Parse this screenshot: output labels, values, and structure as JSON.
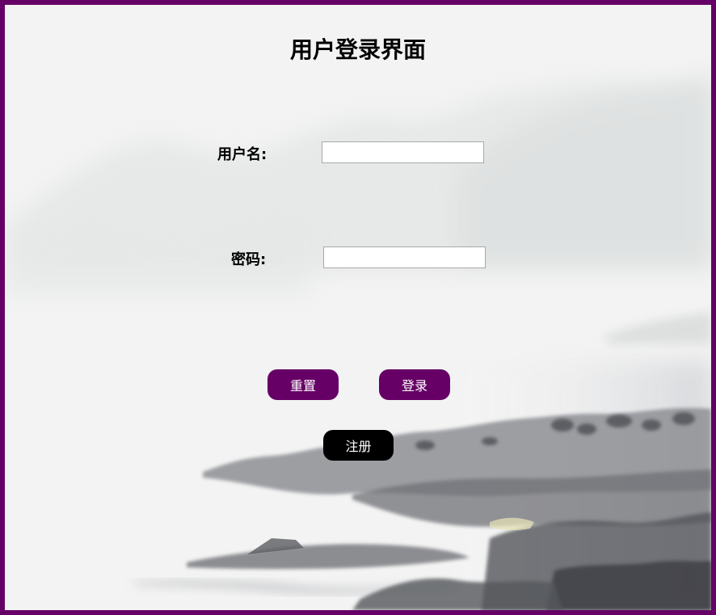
{
  "page": {
    "title": "用户登录界面"
  },
  "form": {
    "username_label": "用户名:",
    "username_value": "",
    "password_label": "密码:",
    "password_value": ""
  },
  "buttons": {
    "reset_label": "重置",
    "login_label": "登录",
    "register_label": "注册"
  },
  "colors": {
    "border": "#660066",
    "primary_button": "#660066",
    "register_button": "#000000"
  }
}
